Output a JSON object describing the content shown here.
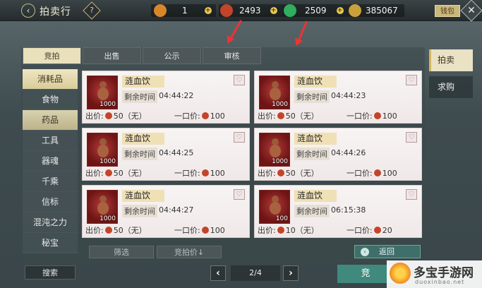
{
  "header": {
    "back_icon": "‹",
    "title": "拍卖行",
    "help": "?",
    "currencies": [
      {
        "icon": "coin-bag-icon",
        "color": "#d8862a",
        "value": "1"
      },
      {
        "icon": "red-coin-icon",
        "color": "#c4442a",
        "value": "2493"
      },
      {
        "icon": "jade-icon",
        "color": "#2fae5e",
        "value": "2509"
      },
      {
        "icon": "gold-ingot-icon",
        "color": "#c9a03a",
        "value": "385067"
      }
    ],
    "plus": "+",
    "wallet_label": "钱包",
    "close_icon": "✕"
  },
  "tabs": [
    "竞拍",
    "出售",
    "公示",
    "审核"
  ],
  "categories": [
    "消耗品",
    "食物",
    "药品",
    "工具",
    "器魂",
    "千乘",
    "信标",
    "混沌之力",
    "秘宝"
  ],
  "side_tabs": [
    "拍卖",
    "求购"
  ],
  "labels": {
    "remaining": "剩余时间",
    "bid": "出价:",
    "buyout": "一口价:",
    "heart": "♡"
  },
  "items": [
    {
      "name": "涟血饮",
      "qty": "1000",
      "time": "04:44:22",
      "bid": "50（无）",
      "buyout": "100"
    },
    {
      "name": "涟血饮",
      "qty": "1000",
      "time": "04:44:23",
      "bid": "50（无）",
      "buyout": "100"
    },
    {
      "name": "涟血饮",
      "qty": "1000",
      "time": "04:44:25",
      "bid": "50（无）",
      "buyout": "100"
    },
    {
      "name": "涟血饮",
      "qty": "1000",
      "time": "04:44:26",
      "bid": "50（无）",
      "buyout": "100"
    },
    {
      "name": "涟血饮",
      "qty": "1000",
      "time": "04:44:27",
      "bid": "50（无）",
      "buyout": "100"
    },
    {
      "name": "涟血饮",
      "qty": "100",
      "time": "06:15:38",
      "bid": "10（无）",
      "buyout": "20"
    }
  ],
  "controls": {
    "filter": "筛选",
    "sort": "竞拍价↓",
    "back": "返回",
    "search": "搜索",
    "prev": "‹",
    "next": "›",
    "page": "2/4",
    "action": "竞"
  },
  "watermark": {
    "text": "多宝手游网",
    "url": "duoxinbao.net"
  }
}
